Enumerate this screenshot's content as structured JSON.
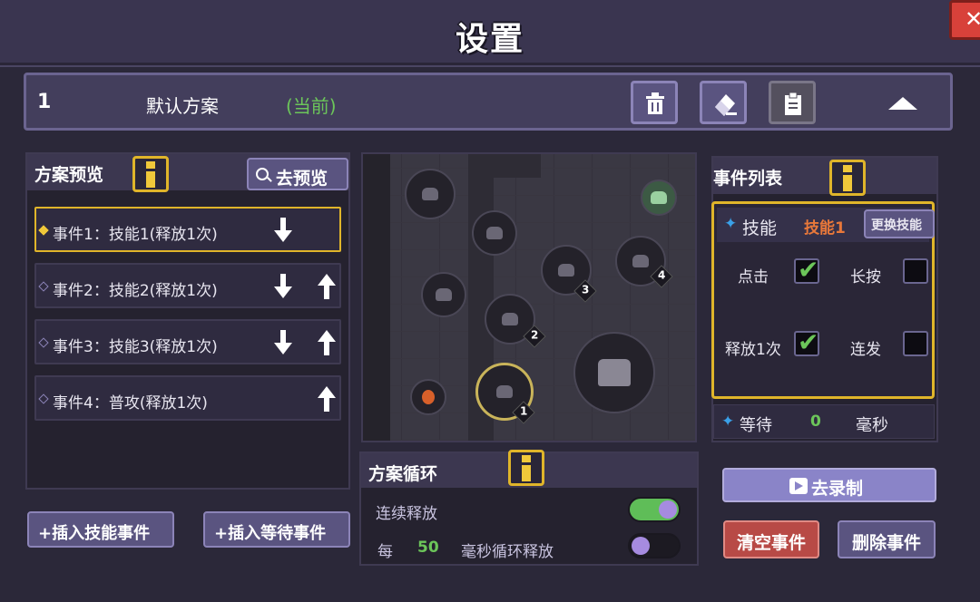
{
  "title": "设置",
  "scheme": {
    "number": "1",
    "name": "默认方案",
    "current_label": "(当前)"
  },
  "icons": {
    "trash": "trash-icon",
    "rename": "eraser-icon",
    "clipboard": "clipboard-icon",
    "collapse": "triangle-up-icon",
    "info": "info-icon",
    "close": "close-icon"
  },
  "preview_panel": {
    "title": "方案预览",
    "preview_button": "去预览",
    "events": [
      {
        "label": "事件1：技能1(释放1次)",
        "active": true,
        "down": true,
        "up": false
      },
      {
        "label": "事件2：技能2(释放1次)",
        "active": false,
        "down": true,
        "up": true
      },
      {
        "label": "事件3：技能3(释放1次)",
        "active": false,
        "down": true,
        "up": true
      },
      {
        "label": "事件4：普攻(释放1次)",
        "active": false,
        "down": false,
        "up": true
      }
    ],
    "insert_skill_button": "+插入技能事件",
    "insert_wait_button": "+插入等待事件"
  },
  "map": {
    "node_tags": [
      "1",
      "2",
      "3",
      "4"
    ]
  },
  "loop_panel": {
    "title": "方案循环",
    "continuous_label": "连续释放",
    "continuous_on": true,
    "every_label": "每",
    "interval_value": "50",
    "interval_suffix": "毫秒循环释放",
    "interval_loop_on": false
  },
  "event_list": {
    "title": "事件列表",
    "skill_label": "技能",
    "skill_value": "技能1",
    "change_skill_button": "更换技能",
    "click_label": "点击",
    "click_checked": true,
    "long_press_label": "长按",
    "long_press_checked": false,
    "release_once_label": "释放1次",
    "release_once_checked": true,
    "burst_label": "连发",
    "burst_checked": false,
    "wait_label": "等待",
    "wait_value": "0",
    "wait_unit": "毫秒"
  },
  "actions": {
    "record_button": "去录制",
    "clear_button": "清空事件",
    "delete_button": "删除事件"
  },
  "colors": {
    "accent_gold": "#e0b52a",
    "green": "#6cc65a",
    "skill_orange": "#e8783a",
    "danger_red": "#b84a46",
    "purple_button": "#5a5480"
  }
}
